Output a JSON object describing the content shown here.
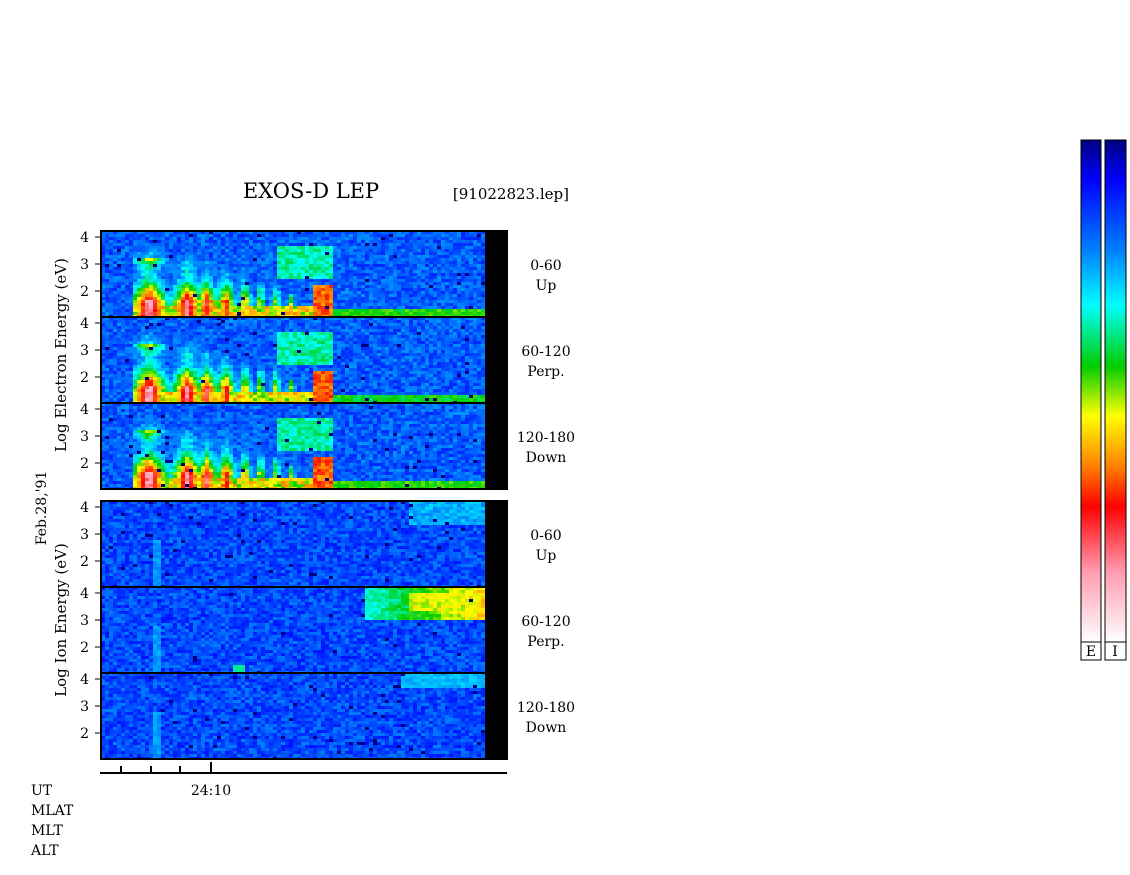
{
  "chart_data": {
    "type": "heatmap",
    "title": "EXOS-D LEP",
    "file_label": "[91022823.lep]",
    "date_label": "Feb.28,'91",
    "x_axis": {
      "tick_label": "24:10",
      "rows": [
        "UT",
        "MLAT",
        "MLT",
        "ALT"
      ]
    },
    "colorbar_labels": [
      "E",
      "I"
    ],
    "colorscale": [
      "#ffffff",
      "#ff9bb0",
      "#ff0000",
      "#ff8000",
      "#ffff00",
      "#00cc00",
      "#00ffff",
      "#0080ff",
      "#0000ff",
      "#000080"
    ],
    "groups": [
      {
        "species": "Electron",
        "ylabel": "Log Electron Energy (eV)",
        "yticks": [
          "4",
          "3",
          "2"
        ],
        "panels": [
          {
            "angle": "0-60",
            "direction": "Up"
          },
          {
            "angle": "60-120",
            "direction": "Perp."
          },
          {
            "angle": "120-180",
            "direction": "Down"
          }
        ]
      },
      {
        "species": "Ion",
        "ylabel": "Log Ion Energy (eV)",
        "yticks": [
          "4",
          "3",
          "2"
        ],
        "panels": [
          {
            "angle": "0-60",
            "direction": "Up"
          },
          {
            "angle": "60-120",
            "direction": "Perp."
          },
          {
            "angle": "120-180",
            "direction": "Down"
          }
        ]
      }
    ]
  }
}
